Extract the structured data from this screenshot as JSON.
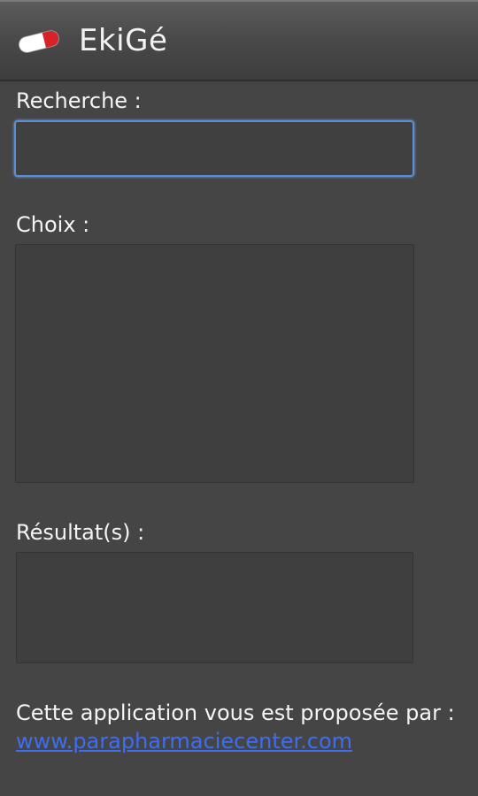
{
  "header": {
    "title": "EkiGé",
    "icon": "pill-icon"
  },
  "search": {
    "label": "Recherche :",
    "value": "",
    "placeholder": ""
  },
  "choices": {
    "label": "Choix :",
    "items": []
  },
  "results": {
    "label": "Résultat(s) :",
    "items": []
  },
  "footer": {
    "text": "Cette application vous est proposée par :",
    "link_text": "www.parapharmaciecenter.com"
  },
  "colors": {
    "background": "#454545",
    "focus_border": "#5b8fd4",
    "link": "#3e6df2",
    "pill_red": "#d8222a"
  }
}
